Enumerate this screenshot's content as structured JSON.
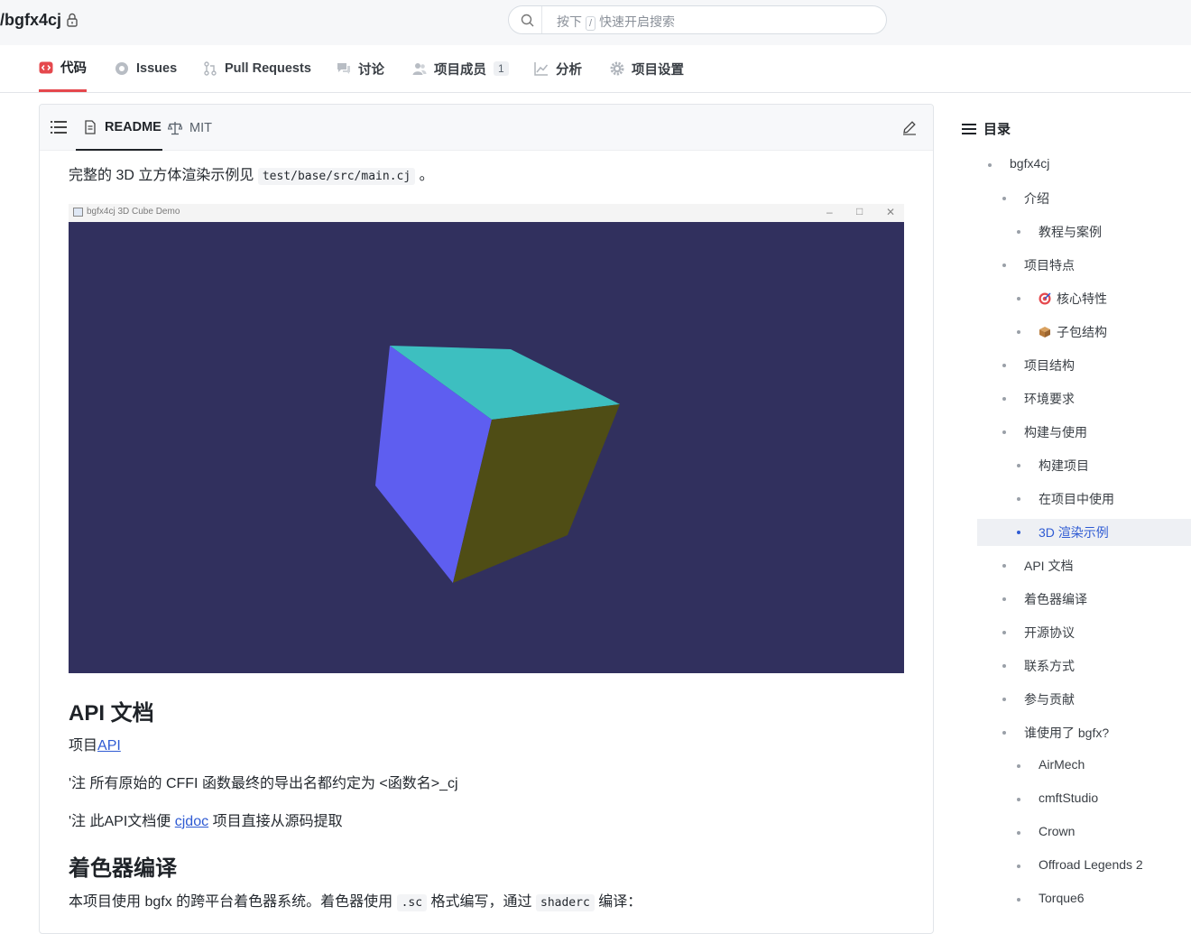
{
  "header": {
    "repo_name": "/bgfx4cj",
    "search": {
      "placeholder_prefix": "按下",
      "shortcut_key": "/",
      "placeholder_suffix": "快速开启搜索"
    }
  },
  "tabs": [
    {
      "label": "代码",
      "icon": "code-icon",
      "active": true
    },
    {
      "label": "Issues",
      "icon": "issue-icon"
    },
    {
      "label": "Pull Requests",
      "icon": "pull-request-icon"
    },
    {
      "label": "讨论",
      "icon": "discussion-icon"
    },
    {
      "label": "项目成员",
      "icon": "members-icon",
      "count": "1"
    },
    {
      "label": "分析",
      "icon": "chart-icon"
    },
    {
      "label": "项目设置",
      "icon": "gear-icon"
    }
  ],
  "readme": {
    "tabs": [
      {
        "label": "README",
        "active": true
      },
      {
        "label": "MIT"
      }
    ],
    "intro_text": "完整的 3D 立方体渲染示例见",
    "intro_code": "test/base/src/main.cj",
    "intro_end": "。",
    "demo_window": {
      "title": "bgfx4cj 3D Cube Demo",
      "background": "#31305e",
      "cube_colors": {
        "top": "#3dbfc0",
        "left": "#5e5ef0",
        "right": "#4f4d15"
      }
    },
    "api_heading": "API 文档",
    "api_line_prefix": "项目",
    "api_link": "API",
    "note1": "'注 所有原始的 CFFI 函数最终的导出名都约定为 <函数名>_cj",
    "note2_prefix": "'注 此API文档便",
    "note2_link": "cjdoc",
    "note2_suffix": "项目直接从源码提取",
    "shader_heading": "着色器编译",
    "shader_text_1": "本项目使用 bgfx 的跨平台着色器系统。着色器使用",
    "shader_code_1": ".sc",
    "shader_text_2": "格式编写，通过",
    "shader_code_2": "shaderc",
    "shader_text_3": "编译："
  },
  "toc": {
    "title": "目录",
    "items": [
      {
        "label": "bgfx4cj",
        "level": 0
      },
      {
        "label": "介绍",
        "level": 1
      },
      {
        "label": "教程与案例",
        "level": 2
      },
      {
        "label": "项目特点",
        "level": 1
      },
      {
        "label": "核心特性",
        "level": 2,
        "emoji": "target"
      },
      {
        "label": "子包结构",
        "level": 2,
        "emoji": "package"
      },
      {
        "label": "项目结构",
        "level": 1
      },
      {
        "label": "环境要求",
        "level": 1
      },
      {
        "label": "构建与使用",
        "level": 1
      },
      {
        "label": "构建项目",
        "level": 2
      },
      {
        "label": "在项目中使用",
        "level": 2
      },
      {
        "label": "3D 渲染示例",
        "level": 2,
        "active": true
      },
      {
        "label": "API 文档",
        "level": 1
      },
      {
        "label": "着色器编译",
        "level": 1
      },
      {
        "label": "开源协议",
        "level": 1
      },
      {
        "label": "联系方式",
        "level": 1
      },
      {
        "label": "参与贡献",
        "level": 1
      },
      {
        "label": "谁使用了 bgfx?",
        "level": 1
      },
      {
        "label": "AirMech",
        "level": 2
      },
      {
        "label": "cmftStudio",
        "level": 2
      },
      {
        "label": "Crown",
        "level": 2
      },
      {
        "label": "Offroad Legends 2",
        "level": 2
      },
      {
        "label": "Torque6",
        "level": 2
      }
    ]
  }
}
